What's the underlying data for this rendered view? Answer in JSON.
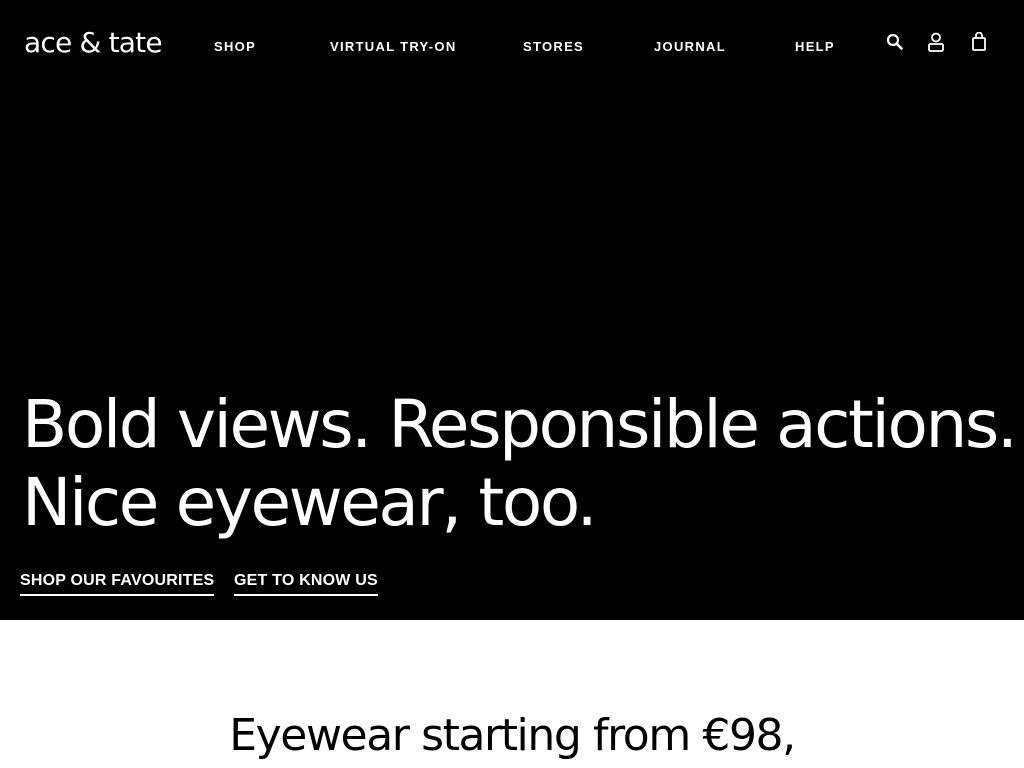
{
  "header": {
    "logo_text": "ace & tate",
    "nav": [
      {
        "label": "SHOP"
      },
      {
        "label": "VIRTUAL TRY-ON"
      },
      {
        "label": "STORES"
      },
      {
        "label": "JOURNAL"
      },
      {
        "label": "HELP"
      }
    ],
    "icons": [
      "search-icon",
      "account-icon",
      "shopping-bag-icon"
    ]
  },
  "hero": {
    "headline_line1": "Bold views. Responsible actions.",
    "headline_line2": "Nice eyewear, too.",
    "cta_primary": "SHOP OUR FAVOURITES",
    "cta_secondary": "GET TO KNOW US",
    "background_color": "#000000",
    "text_color": "#ffffff"
  },
  "promo": {
    "text": "Eyewear starting from €98,"
  }
}
